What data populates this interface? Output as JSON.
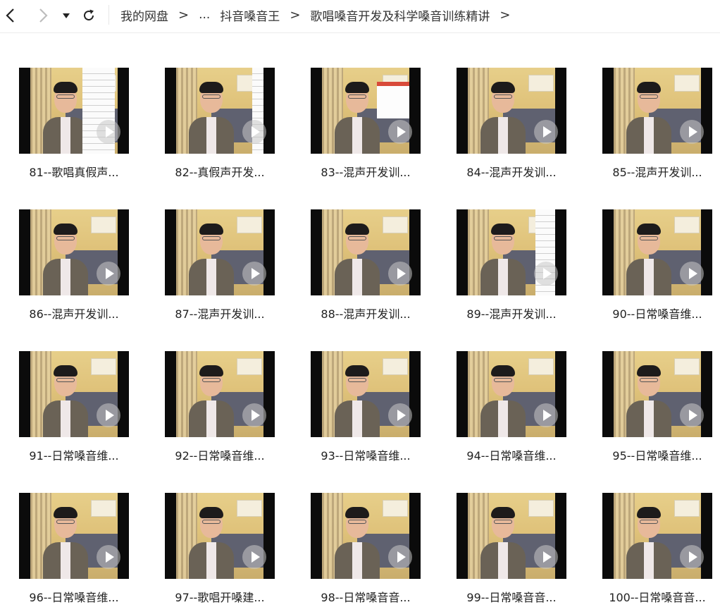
{
  "toolbar": {
    "back_icon": "chevron-left-icon",
    "forward_icon": "chevron-right-icon",
    "dropdown_icon": "caret-down-icon",
    "refresh_icon": "refresh-icon"
  },
  "breadcrumb": {
    "items": [
      {
        "label": "我的网盘"
      },
      {
        "label": "..."
      },
      {
        "label": "抖音嗓音王"
      },
      {
        "label": "歌唱嗓音开发及科学嗓音训练精讲"
      }
    ],
    "separator": ">"
  },
  "files": [
    {
      "name": "81--歌唱真假声...",
      "overlay": "sheet-right"
    },
    {
      "name": "82--真假声开发...",
      "overlay": "sheet-right"
    },
    {
      "name": "83--混声开发训...",
      "overlay": "slide"
    },
    {
      "name": "84--混声开发训...",
      "overlay": "none"
    },
    {
      "name": "85--混声开发训...",
      "overlay": "none"
    },
    {
      "name": "86--混声开发训...",
      "overlay": "none"
    },
    {
      "name": "87--混声开发训...",
      "overlay": "none"
    },
    {
      "name": "88--混声开发训...",
      "overlay": "none"
    },
    {
      "name": "89--混声开发训...",
      "overlay": "sheet-right"
    },
    {
      "name": "90--日常嗓音维...",
      "overlay": "none"
    },
    {
      "name": "91--日常嗓音维...",
      "overlay": "none"
    },
    {
      "name": "92--日常嗓音维...",
      "overlay": "none"
    },
    {
      "name": "93--日常嗓音维...",
      "overlay": "none"
    },
    {
      "name": "94--日常嗓音维...",
      "overlay": "none"
    },
    {
      "name": "95--日常嗓音维...",
      "overlay": "none"
    },
    {
      "name": "96--日常嗓音维...",
      "overlay": "none"
    },
    {
      "name": "97--歌唱开嗓建...",
      "overlay": "none"
    },
    {
      "name": "98--日常嗓音音...",
      "overlay": "none"
    },
    {
      "name": "99--日常嗓音音...",
      "overlay": "none"
    },
    {
      "name": "100--日常嗓音音...",
      "overlay": "none"
    }
  ],
  "colors": {
    "text": "#222222",
    "thumb_border": "#0b0b0b",
    "background": "#ffffff"
  }
}
